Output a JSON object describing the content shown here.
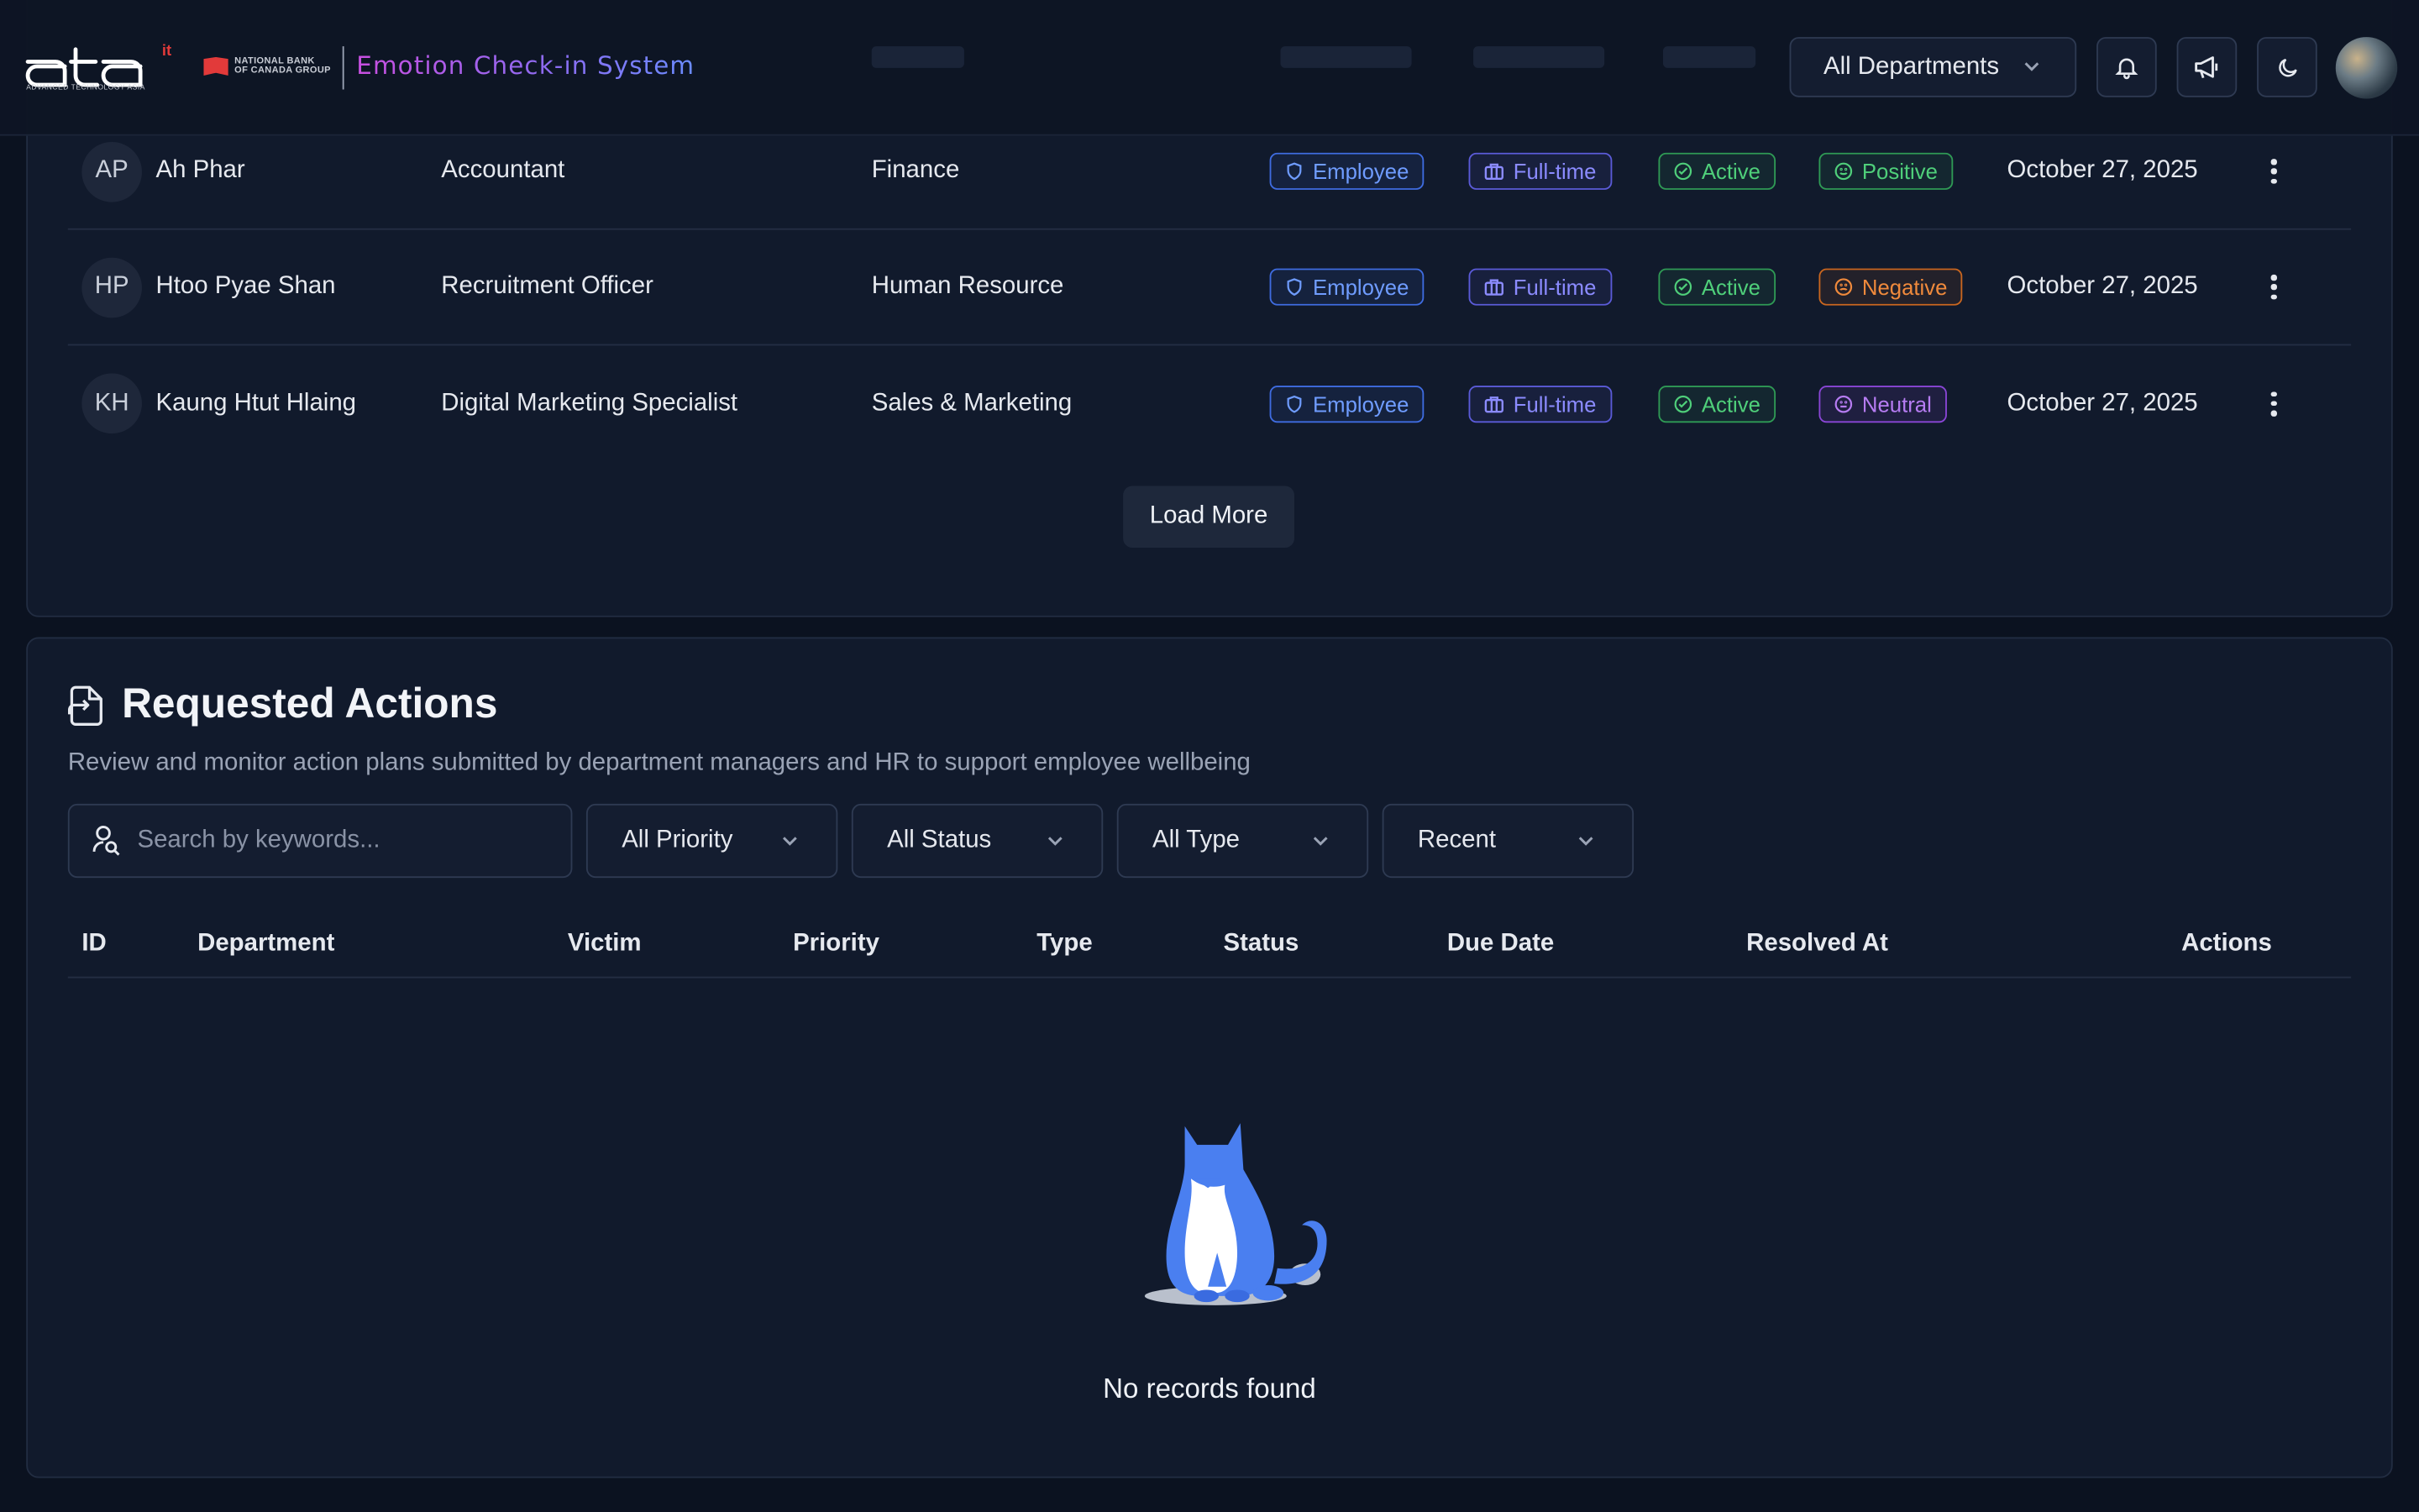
{
  "header": {
    "logo_text": "ata",
    "logo_superscript": "it",
    "logo_tagline": "ADVANCED TECHNOLOGY ASIA",
    "partner_line1": "NATIONAL BANK",
    "partner_line2": "OF CANADA GROUP",
    "system_title": "Emotion Check-in System",
    "department_filter": "All Departments"
  },
  "employees": [
    {
      "initials": "AP",
      "name": "Ah Phar",
      "role": "Accountant",
      "department": "Finance",
      "type": "Employee",
      "employment": "Full-time",
      "status": "Active",
      "emotion": "Positive",
      "date": "October 27, 2025"
    },
    {
      "initials": "HP",
      "name": "Htoo Pyae Shan",
      "role": "Recruitment Officer",
      "department": "Human Resource",
      "type": "Employee",
      "employment": "Full-time",
      "status": "Active",
      "emotion": "Negative",
      "date": "October 27, 2025"
    },
    {
      "initials": "KH",
      "name": "Kaung Htut Hlaing",
      "role": "Digital Marketing Specialist",
      "department": "Sales & Marketing",
      "type": "Employee",
      "employment": "Full-time",
      "status": "Active",
      "emotion": "Neutral",
      "date": "October 27, 2025"
    }
  ],
  "load_more_label": "Load More",
  "requested_actions": {
    "title": "Requested Actions",
    "subtitle": "Review and monitor action plans submitted by department managers and HR to support employee wellbeing",
    "search_placeholder": "Search by keywords...",
    "filters": {
      "priority": "All Priority",
      "status": "All Status",
      "type": "All Type",
      "sort": "Recent"
    },
    "columns": [
      "ID",
      "Department",
      "Victim",
      "Priority",
      "Type",
      "Status",
      "Due Date",
      "Resolved At",
      "Actions"
    ],
    "empty_message": "No records found"
  },
  "colors": {
    "background": "#0b1220",
    "card": "#111a2c",
    "employee_badge": "#6f9cff",
    "fulltime_badge": "#8b8bff",
    "active_badge": "#4fcf7a",
    "negative_badge": "#f08a3c",
    "neutral_badge": "#b67cf2",
    "cat_illustration": "#4a7ff0"
  }
}
